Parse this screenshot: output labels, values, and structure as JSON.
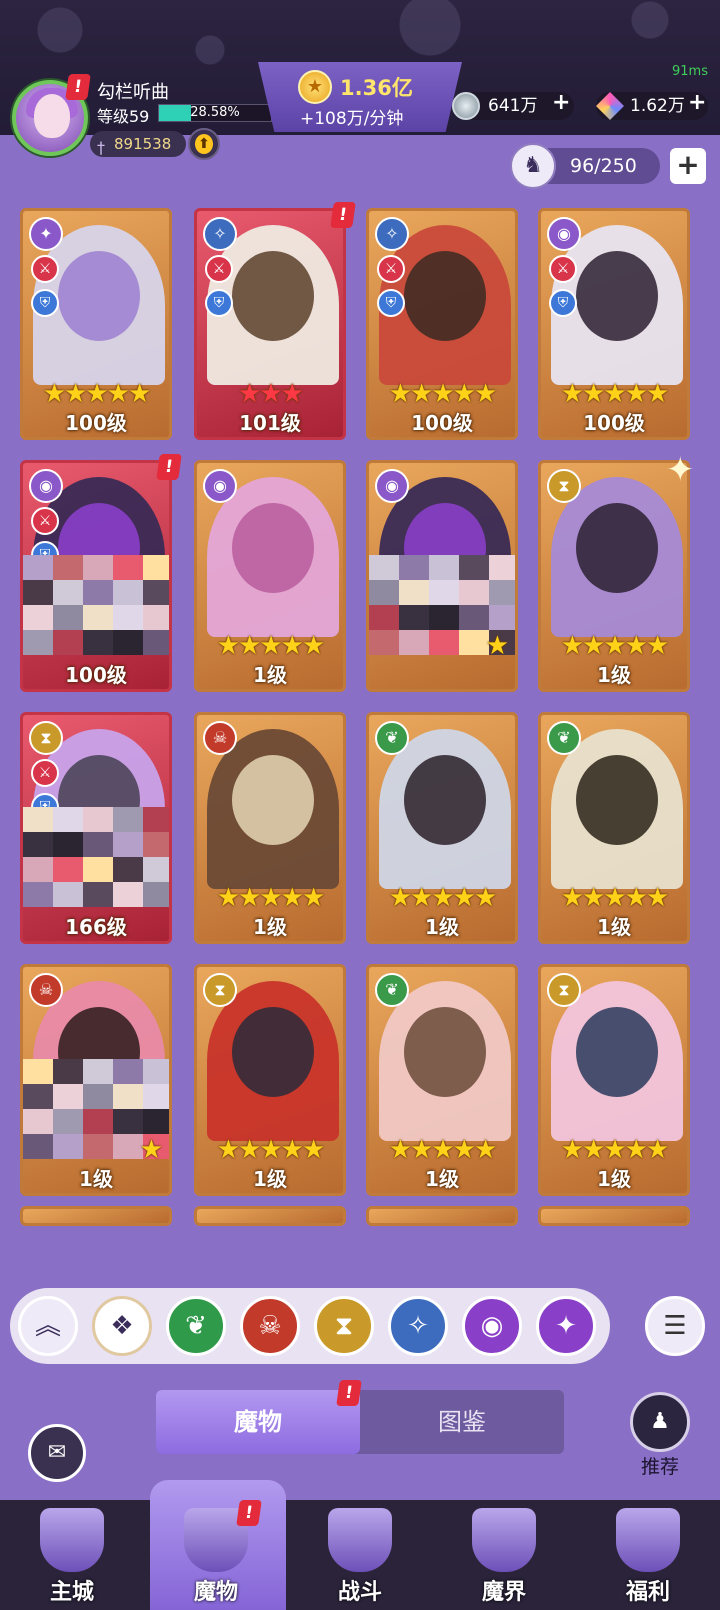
{
  "status": {
    "fps": "91ms"
  },
  "player": {
    "name": "勾栏听曲",
    "level": "等级59",
    "xp_percent": "28.58%",
    "xp_fraction": 0.2858,
    "power": "891538"
  },
  "currency": {
    "gold": "1.36亿",
    "gold_rate": "+108万/分钟",
    "res1": "641万",
    "res2": "1.62万",
    "plus": "+"
  },
  "capacity": {
    "text": "96/250",
    "plus": "+"
  },
  "cards": [
    {
      "level": "100级",
      "stars": "★★★★★",
      "frame": "gold",
      "cls": "✦",
      "cls_color": "#8a58c9",
      "art": "#d7d4ea",
      "art2": "#9b7fd0",
      "roles": true
    },
    {
      "level": "101级",
      "stars": "★★★",
      "frame": "red",
      "cls": "✧",
      "cls_color": "#3d6cbf",
      "art": "#efeae2",
      "art2": "#5a3f2a",
      "roles": true,
      "alert": true
    },
    {
      "level": "100级",
      "stars": "★★★★★",
      "frame": "gold",
      "cls": "✧",
      "cls_color": "#3d6cbf",
      "art": "#c94a3b",
      "art2": "#3a2a22",
      "roles": true
    },
    {
      "level": "100级",
      "stars": "★★★★★",
      "frame": "gold",
      "cls": "◉",
      "cls_color": "#8a58c9",
      "art": "#e8e4f0",
      "art2": "#2b2030",
      "roles": true
    },
    {
      "level": "100级",
      "stars": "",
      "frame": "red",
      "cls": "◉",
      "cls_color": "#8a58c9",
      "art": "#3a2a55",
      "art2": "#8d3fd0",
      "roles": true,
      "alert": true,
      "mosaic": true
    },
    {
      "level": "1级",
      "stars": "★★★★★",
      "frame": "gold",
      "cls": "◉",
      "cls_color": "#8a58c9",
      "art": "#e4a6d8",
      "art2": "#b85c9c"
    },
    {
      "level": "",
      "stars": "★",
      "frame": "gold",
      "cls": "◉",
      "cls_color": "#8a58c9",
      "art": "#3a2a55",
      "art2": "#8d3fd0",
      "mosaic": true
    },
    {
      "level": "1级",
      "stars": "★★★★★",
      "frame": "gold",
      "cls": "⧗",
      "cls_color": "#c99a2a",
      "art": "#a78ad6",
      "art2": "#2a2030",
      "sparkle": true
    },
    {
      "level": "166级",
      "stars": "",
      "frame": "red",
      "cls": "⧗",
      "cls_color": "#c99a2a",
      "art": "#c8a2ea",
      "art2": "#454052",
      "roles": true,
      "mosaic": true
    },
    {
      "level": "1级",
      "stars": "★★★★★",
      "frame": "gold",
      "cls": "☠",
      "cls_color": "#c23a2a",
      "art": "#6b4a36",
      "art2": "#e4d6b4"
    },
    {
      "level": "1级",
      "stars": "★★★★★",
      "frame": "gold",
      "cls": "❦",
      "cls_color": "#3b9a4a",
      "art": "#cfd6e6",
      "art2": "#2a2028"
    },
    {
      "level": "1级",
      "stars": "★★★★★",
      "frame": "gold",
      "cls": "❦",
      "cls_color": "#3b9a4a",
      "art": "#e8e0cc",
      "art2": "#2a2418"
    },
    {
      "level": "1级",
      "stars": "★",
      "frame": "gold",
      "cls": "☠",
      "cls_color": "#c23a2a",
      "art": "#e88aa8",
      "art2": "#2a1a1a",
      "mosaic": true
    },
    {
      "level": "1级",
      "stars": "★★★★★",
      "frame": "gold",
      "cls": "⧗",
      "cls_color": "#c99a2a",
      "art": "#c8342a",
      "art2": "#2a2a3a"
    },
    {
      "level": "1级",
      "stars": "★★★★★",
      "frame": "gold",
      "cls": "❦",
      "cls_color": "#3b9a4a",
      "art": "#f0c8c4",
      "art2": "#6a4a3a"
    },
    {
      "level": "1级",
      "stars": "★★★★★",
      "frame": "gold",
      "cls": "⧗",
      "cls_color": "#c99a2a",
      "art": "#f2c4dc",
      "art2": "#2a3a5a"
    }
  ],
  "filters": [
    {
      "icon": "❦",
      "color": "#2f9a4a"
    },
    {
      "icon": "☠",
      "color": "#c23a2a"
    },
    {
      "icon": "⧗",
      "color": "#c99a2a"
    },
    {
      "icon": "✧",
      "color": "#3d6cbf"
    },
    {
      "icon": "◉",
      "color": "#8a3fc9"
    },
    {
      "icon": "✦",
      "color": "#8a3fc9"
    }
  ],
  "tabs": {
    "monsters": "魔物",
    "codex": "图鉴"
  },
  "recommend": {
    "label": "推荐"
  },
  "nav": [
    {
      "label": "主城"
    },
    {
      "label": "魔物"
    },
    {
      "label": "战斗"
    },
    {
      "label": "魔界"
    },
    {
      "label": "福利"
    }
  ]
}
